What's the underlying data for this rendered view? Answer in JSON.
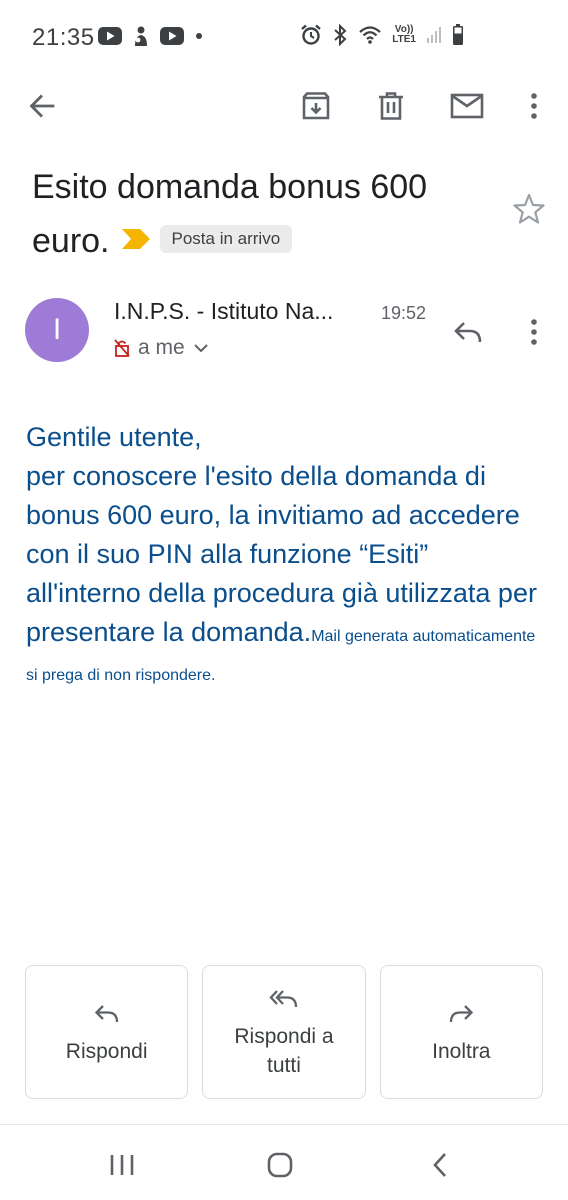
{
  "status_bar": {
    "time": "21:35",
    "left_icons": [
      "youtube-icon",
      "app-icon",
      "youtube-icon",
      "dot-icon"
    ],
    "right_icons": [
      "alarm-icon",
      "bluetooth-icon",
      "wifi-icon",
      "volte-icon",
      "signal-icon",
      "battery-icon"
    ],
    "volte_label": "Vo))",
    "lte_label": "LTE1"
  },
  "toolbar": {
    "back_icon": "arrow-back-icon",
    "archive_icon": "archive-icon",
    "delete_icon": "trash-icon",
    "mark_unread_icon": "mail-icon",
    "more_icon": "more-vert-icon"
  },
  "email": {
    "subject": "Esito domanda bonus 600 euro.",
    "label": "Posta in arrivo",
    "sender": {
      "initial": "I",
      "name": "I.N.P.S. - Istituto Na...",
      "time": "19:52",
      "recipient": "a me",
      "avatar_color": "#9e7bd6"
    },
    "body_main": "Gentile utente, per conoscere l'esito della domanda di bonus 600 euro, la invitiamo ad accedere con il suo PIN alla funzione “Esiti” all'interno della procedura già utilizzata per presentare la domanda.",
    "body_note": "Mail generata automaticamente si prega di non rispondere.",
    "body_color": "#0b4e8c"
  },
  "actions": {
    "reply": "Rispondi",
    "reply_all": "Rispondi a tutti",
    "forward": "Inoltra"
  },
  "colors": {
    "importance_marker": "#f4b400",
    "unsafe_icon": "#c5221f"
  }
}
